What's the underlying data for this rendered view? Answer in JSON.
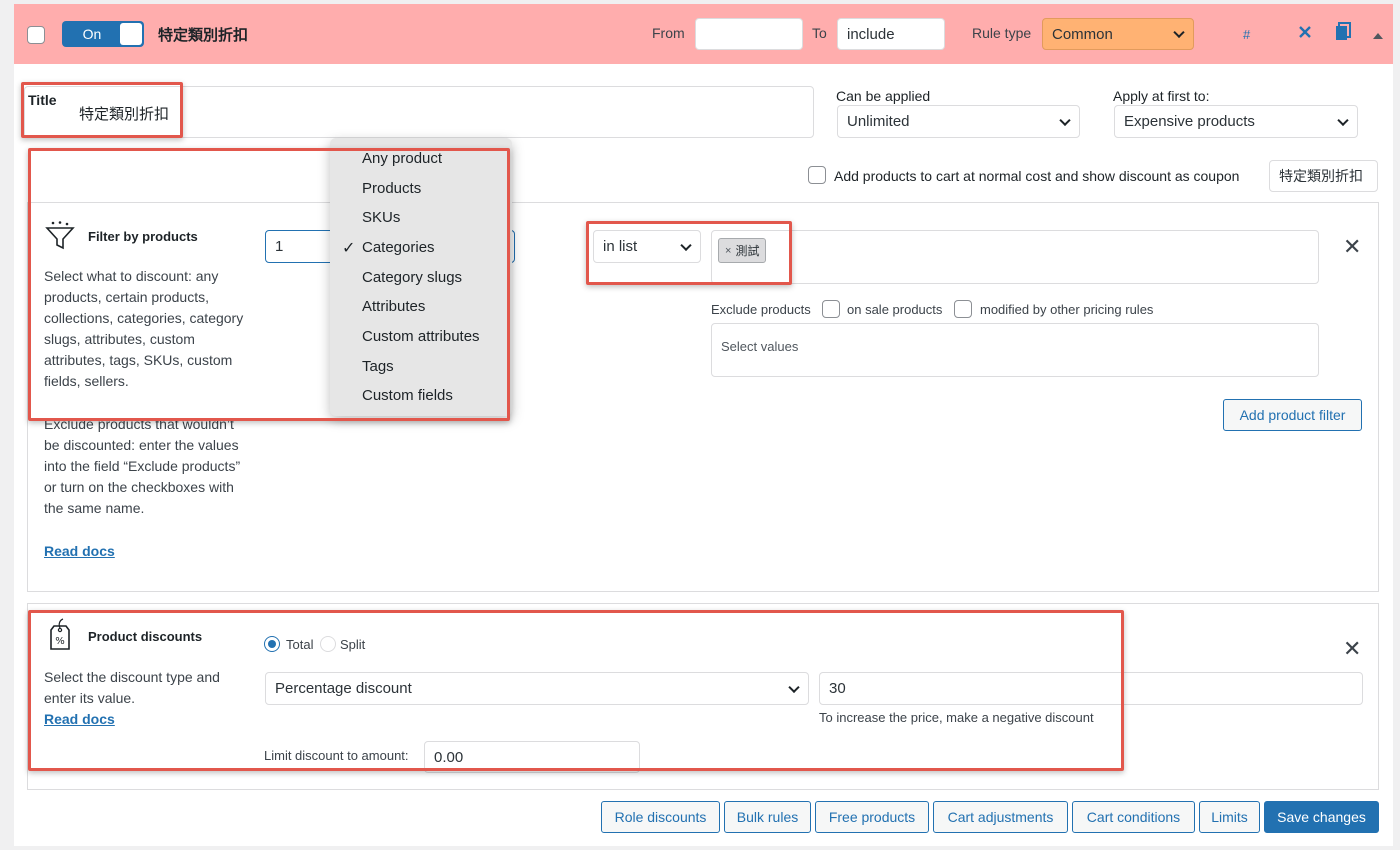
{
  "header": {
    "toggle_label": "On",
    "rule_name": "特定類別折扣",
    "from_label": "From",
    "from_value": "",
    "to_label": "To",
    "to_value": "include",
    "rule_type_label": "Rule type",
    "rule_type_value": "Common",
    "hash_label": "#",
    "bg_color": "#ffadad"
  },
  "title_field": {
    "label": "Title",
    "value": "特定類別折扣"
  },
  "can_be_applied": {
    "label": "Can be applied",
    "value": "Unlimited"
  },
  "apply_first": {
    "label": "Apply at first to:",
    "value": "Expensive products"
  },
  "coupon": {
    "label": "Add products to cart at normal cost and show discount as coupon",
    "value": "特定類別折扣"
  },
  "filter": {
    "title": "Filter by products",
    "desc1": "Select what to discount: any products, certain products, collections, categories, category slugs, attributes, custom attributes, tags, SKUs, custom fields, sellers.",
    "desc2": "Exclude products that wouldn’t be discounted: enter the values into the field “Exclude products” or turn on the checkboxes with the same name.",
    "read_docs": "Read docs",
    "qty_value": "1",
    "operator": "in list",
    "tag": "測試",
    "exclude_label": "Exclude products",
    "on_sale_label": "on sale products",
    "modified_label": "modified by other pricing rules",
    "select_placeholder": "Select values",
    "add_filter_button": "Add product filter"
  },
  "dropdown_items": [
    {
      "label": "Any product",
      "checked": false
    },
    {
      "label": "Products",
      "checked": false
    },
    {
      "label": "SKUs",
      "checked": false
    },
    {
      "label": "Categories",
      "checked": true
    },
    {
      "label": "Category slugs",
      "checked": false
    },
    {
      "label": "Attributes",
      "checked": false
    },
    {
      "label": "Custom attributes",
      "checked": false
    },
    {
      "label": "Tags",
      "checked": false
    },
    {
      "label": "Custom fields",
      "checked": false
    }
  ],
  "check_mark": "✓",
  "discount": {
    "title": "Product discounts",
    "desc": "Select the discount type and enter its value.",
    "read_docs": "Read docs",
    "radio_total": "Total",
    "radio_split": "Split",
    "type_value": "Percentage discount",
    "amount_value": "30",
    "hint": "To increase the price, make a negative discount",
    "limit_label": "Limit discount to amount:",
    "limit_value": "0.00"
  },
  "footer_buttons": [
    "Role discounts",
    "Bulk rules",
    "Free products",
    "Cart adjustments",
    "Cart conditions",
    "Limits",
    "Save changes"
  ],
  "colors": {
    "accent": "#2271b1",
    "highlight": "#e2574c",
    "rule_type_bg": "#ffb273"
  }
}
